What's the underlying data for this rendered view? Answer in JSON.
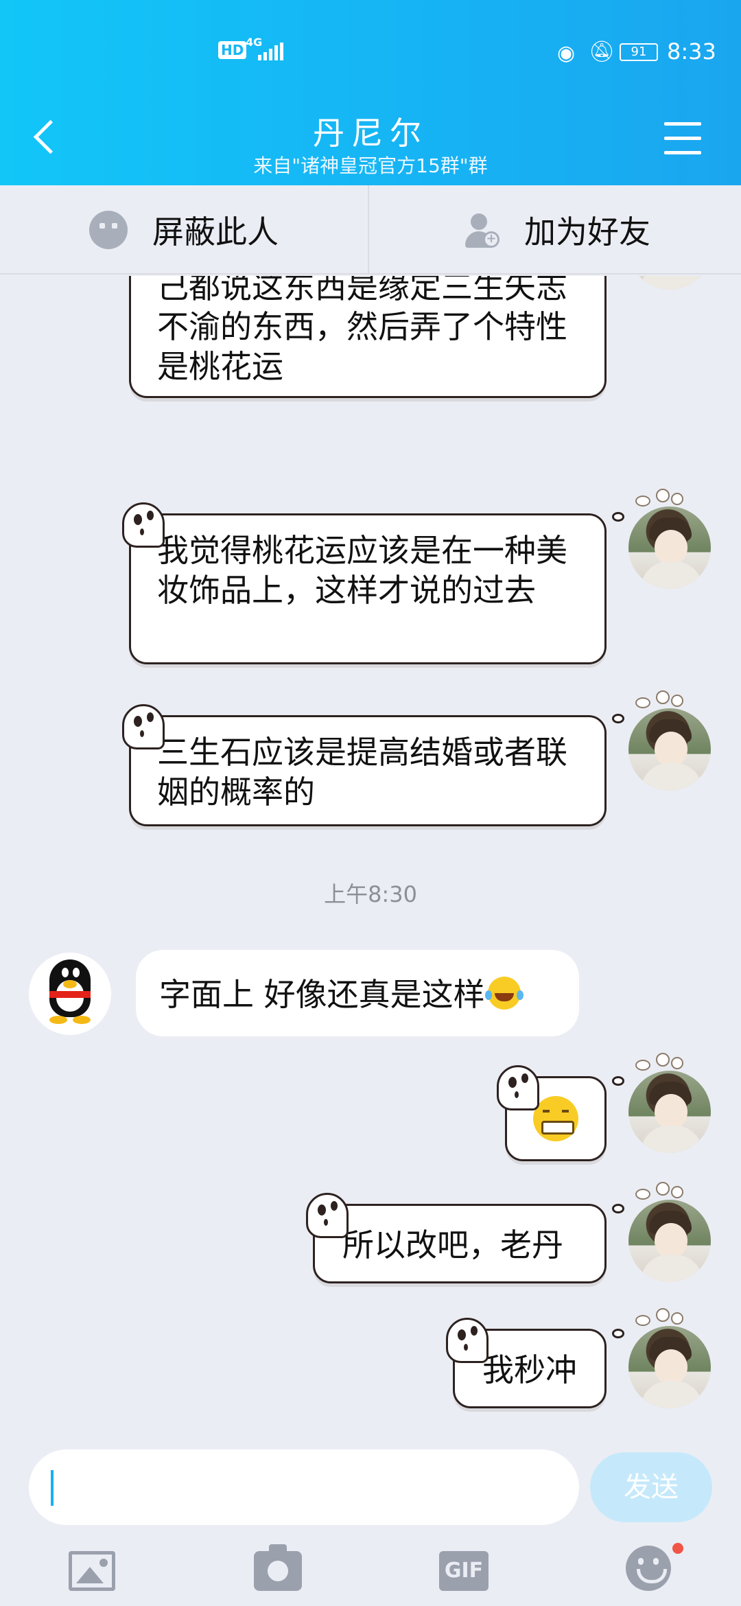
{
  "status_bar": {
    "hd": "HD",
    "network": "4G",
    "battery": "91",
    "time": "8:33"
  },
  "header": {
    "title": "丹尼尔",
    "subtitle": "来自\"诸神皇冠官方15群\"群",
    "back_icon": "chevron-left-icon",
    "menu_icon": "hamburger-menu-icon"
  },
  "actions": {
    "block_label": "屏蔽此人",
    "add_friend_label": "加为好友"
  },
  "messages": [
    {
      "side": "right",
      "text": "老刀，关于饰品三生石的特性，是不是不太合理，你们自己都说这东西是缘定三生矢志不渝的东西，然后弄了个特性是桃花运"
    },
    {
      "side": "right",
      "text": "我觉得桃花运应该是在一种美妆饰品上，这样才说的过去"
    },
    {
      "side": "right",
      "text": "三生石应该是提高结婚或者联姻的概率的"
    },
    {
      "side": "left",
      "text": "字面上 好像还真是这样",
      "emoji": "laugh-cry-emoji"
    },
    {
      "side": "right",
      "emoji": "grin-emoji"
    },
    {
      "side": "right",
      "text": "所以改吧，老丹"
    },
    {
      "side": "right",
      "text": "我秒冲"
    }
  ],
  "timestamp": "上午8:30",
  "input": {
    "placeholder": "",
    "send_label": "发送"
  },
  "toolbar": [
    "image-icon",
    "camera-icon",
    "gif-icon",
    "emoji-icon"
  ],
  "toolbar_gif": "GIF",
  "colors": {
    "header_gradient_start": "#12c6f8",
    "header_gradient_end": "#1aa6ef",
    "background": "#ebedf4",
    "send_button": "#c5e9fb"
  }
}
